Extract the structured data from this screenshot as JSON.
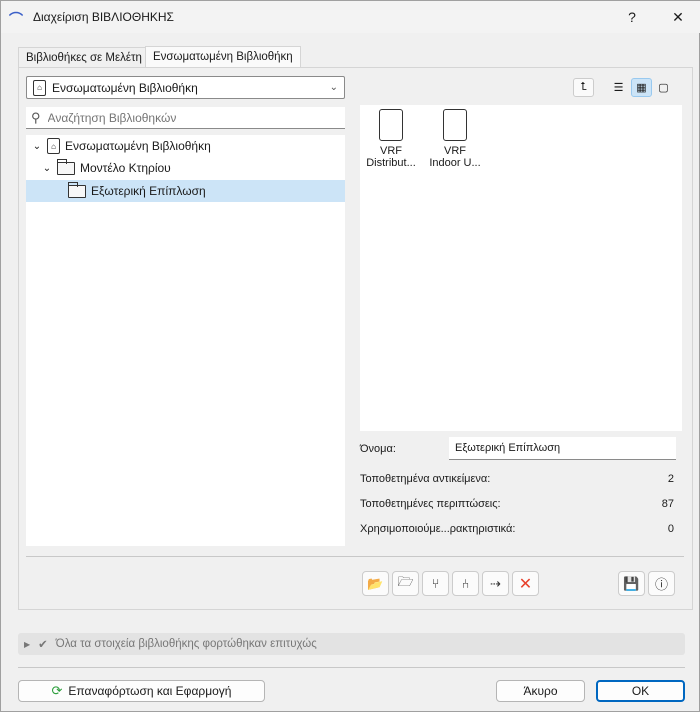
{
  "window": {
    "title": "Διαχείριση ΒΙΒΛΙΟΘΗΚΗΣ",
    "help": "?",
    "close": "✕"
  },
  "tabs": [
    {
      "label": "Βιβλιοθήκες σε Μελέτη"
    },
    {
      "label": "Ενσωματωμένη Βιβλιοθήκη"
    }
  ],
  "dropdown": {
    "value": "Ενσωματωμένη Βιβλιοθήκη"
  },
  "search": {
    "placeholder": "Αναζήτηση Βιβλιοθηκών"
  },
  "tree": [
    {
      "label": "Ενσωματωμένη Βιβλιοθήκη"
    },
    {
      "label": "Μοντέλο Κτηρίου"
    },
    {
      "label": "Εξωτερική Επίπλωση"
    }
  ],
  "items": [
    {
      "line1": "VRF",
      "line2": "Distribut..."
    },
    {
      "line1": "VRF",
      "line2": "Indoor U..."
    }
  ],
  "properties": {
    "name_label": "Όνομα:",
    "name_value": "Εξωτερική Επίπλωση",
    "rows": [
      {
        "label": "Τοποθετημένα αντικείμενα:",
        "value": "2"
      },
      {
        "label": "Τοποθετημένες περιπτώσεις:",
        "value": "87"
      },
      {
        "label": "Χρησιμοποιούμε...ρακτηριστικά:",
        "value": "0"
      }
    ]
  },
  "status": {
    "text": "Όλα τα στοιχεία βιβλιοθήκης φορτώθηκαν επιτυχώς"
  },
  "buttons": {
    "reload": "Επαναφόρτωση και Εφαρμογή",
    "cancel": "Άκυρο",
    "ok": "OK"
  },
  "colors": {
    "accent": "#0067c0",
    "selected": "#cce4f7",
    "delete": "#e8412c"
  }
}
